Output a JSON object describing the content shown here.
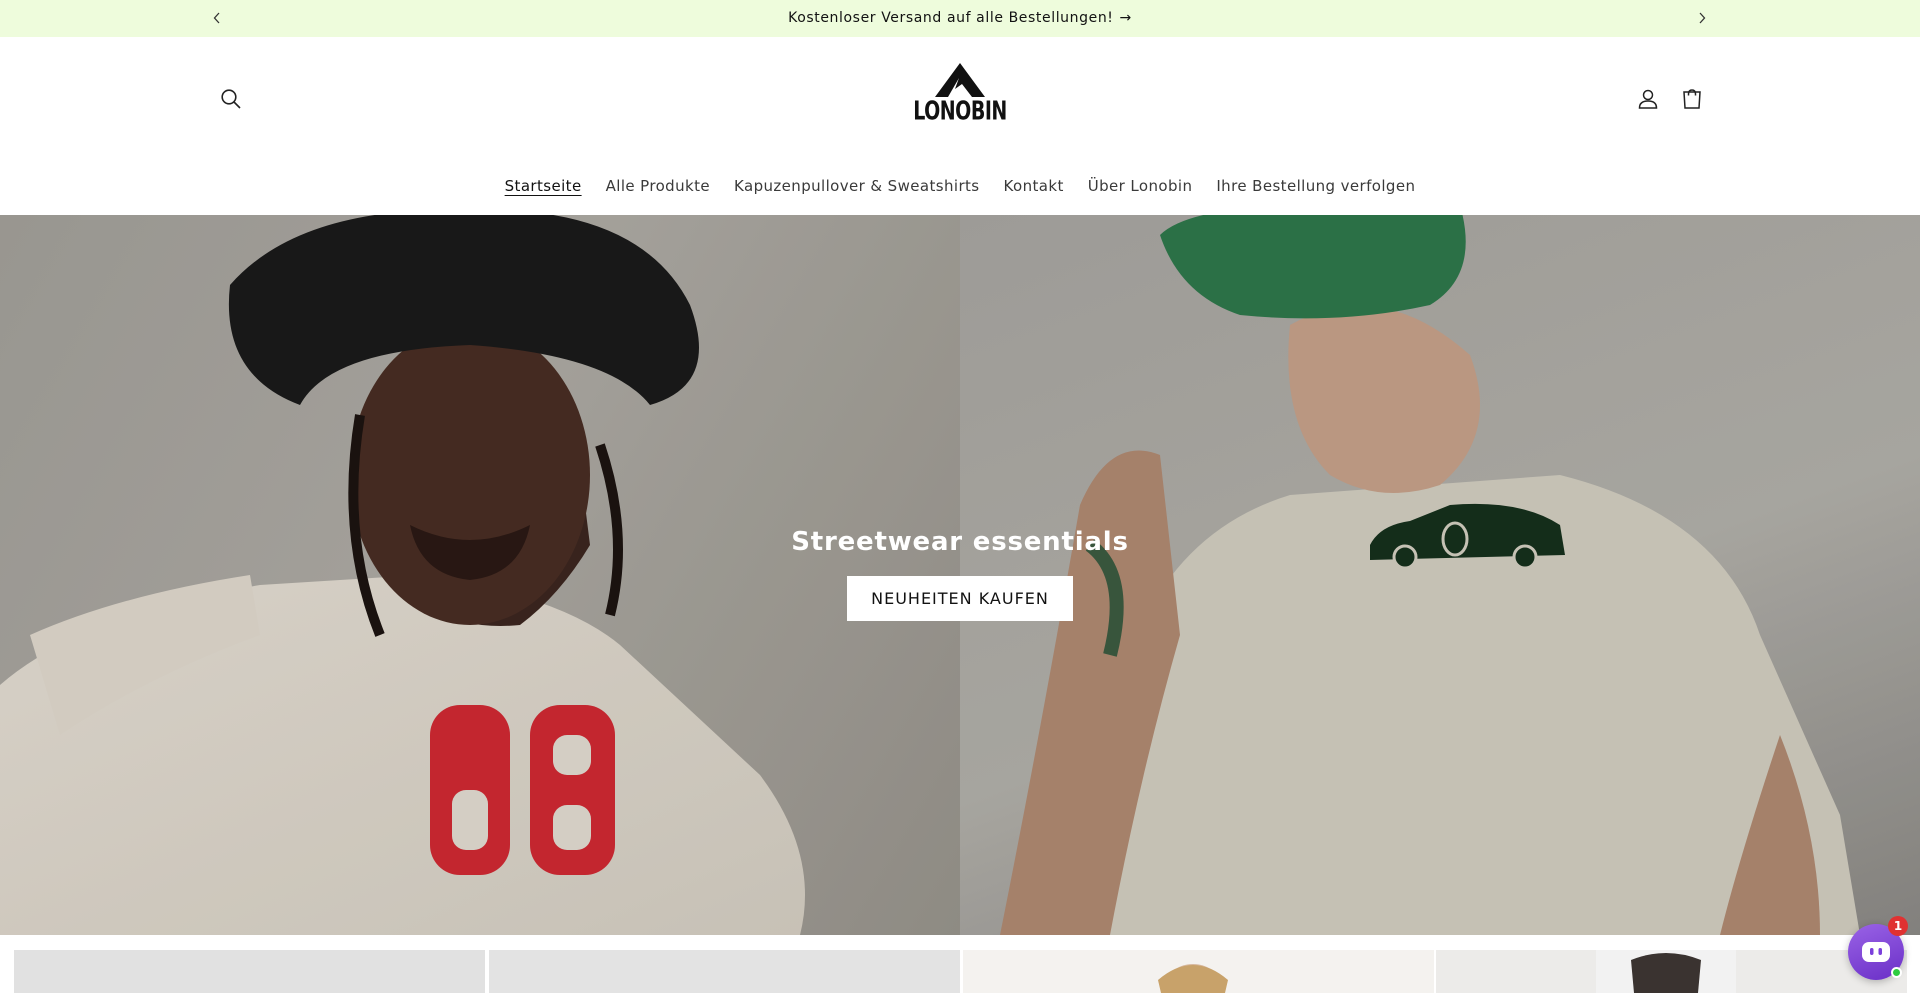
{
  "announcement": {
    "message": "Kostenloser Versand auf alle Bestellungen!",
    "arrow": "→"
  },
  "header": {
    "logo_text": "LONOBIN",
    "nav": [
      {
        "label": "Startseite",
        "active": true
      },
      {
        "label": "Alle Produkte",
        "active": false
      },
      {
        "label": "Kapuzenpullover & Sweatshirts",
        "active": false
      },
      {
        "label": "Kontakt",
        "active": false
      },
      {
        "label": "Über Lonobin",
        "active": false
      },
      {
        "label": "Ihre Bestellung verfolgen",
        "active": false
      }
    ],
    "icons": {
      "search": "search-icon",
      "account": "account-icon",
      "cart": "cart-icon"
    }
  },
  "hero": {
    "title": "Streetwear essentials",
    "button_label": "NEUHEITEN KAUFEN",
    "left_shirt_number": "68"
  },
  "chat": {
    "unread_count": "1",
    "accent": "#7b3fdb",
    "status_color": "#2ecc40"
  },
  "colors": {
    "announcement_bg": "#eefcdc"
  }
}
